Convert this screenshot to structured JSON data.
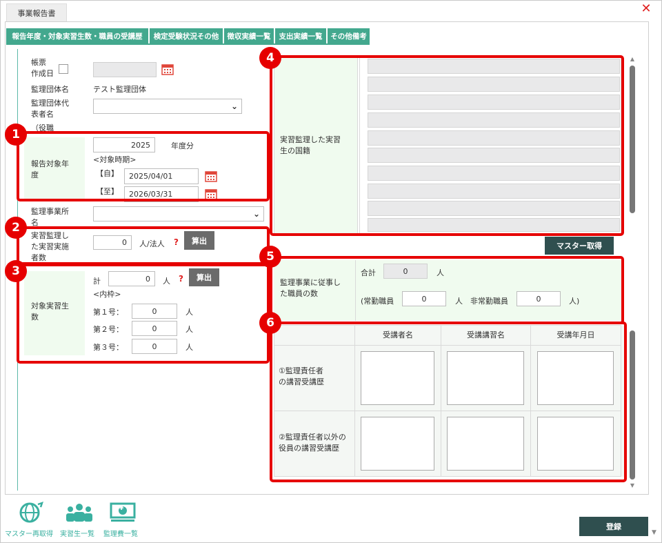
{
  "window": {
    "title": "事業報告書",
    "close": "✕"
  },
  "tabs": [
    "報告年度・対象実習生数・職員の受講歴",
    "検定受験状況その他",
    "徴収実績一覧",
    "支出実績一覧",
    "その他備考"
  ],
  "form": {
    "chohyo_label_1": "帳票",
    "chohyo_label_2": "作成日",
    "dantai_label": "監理団体名",
    "dantai_value": "テスト監理団体",
    "daihyo_label_1": "監理団体代",
    "daihyo_label_2": "表者名",
    "yakushoku_label": "（役職",
    "nendo_label_1": "報告対象年",
    "nendo_label_2": "度",
    "nendo_value": "2025",
    "nendo_unit": "年度分",
    "kikan_label": "<対象時期>",
    "from_label": "【自】",
    "from_value": "2025/04/01",
    "to_label": "【至】",
    "to_value": "2026/03/31",
    "jigyosho_label_1": "監理事業所",
    "jigyosho_label_2": "名",
    "jisshi_label_1": "実習監理し",
    "jisshi_label_2": "た実習実施",
    "jisshi_label_3": "者数",
    "jisshi_value": "0",
    "jisshi_unit": "人/法人",
    "calc_label": "算出",
    "taisho_label_1": "対象実習生",
    "taisho_label_2": "数",
    "kei_label": "計",
    "kei_value": "0",
    "kei_unit": "人",
    "uchiwake_label": "<内枠>",
    "go1_label": "第１号：",
    "go1_value": "0",
    "go2_label": "第２号：",
    "go2_value": "0",
    "go3_label": "第３号：",
    "go3_value": "0",
    "person_unit": "人",
    "kokuseki_label_1": "実習監理した実習",
    "kokuseki_label_2": "生の国籍",
    "master_button": "マスター取得",
    "shokuin_label_1": "監理事業に従事し",
    "shokuin_label_2": "た職員の数",
    "gokei_label": "合計",
    "gokei_value": "0",
    "jokin_label": "(常勤職員",
    "jokin_value": "0",
    "hijokin_label": "非常勤職員",
    "hijokin_value": "0",
    "paren_close": "人)",
    "jukou_headers": [
      "受講者名",
      "受講講習名",
      "受講年月日"
    ],
    "jukou_row1_1": "①監理責任者",
    "jukou_row1_2": "の講習受講歴",
    "jukou_row2_1": "②監理責任者以外の",
    "jukou_row2_2": "役員の講習受講歴"
  },
  "badges": [
    "1",
    "2",
    "3",
    "4",
    "5",
    "6"
  ],
  "footer": {
    "master_reload": "マスター再取得",
    "students": "実習生一覧",
    "fees": "監理費一覧",
    "register": "登録",
    "fee_symbol": "¥"
  },
  "colors": {
    "tab_green": "#43a88e",
    "highlight_red": "#e60000",
    "label_bg": "#f0fbef"
  }
}
